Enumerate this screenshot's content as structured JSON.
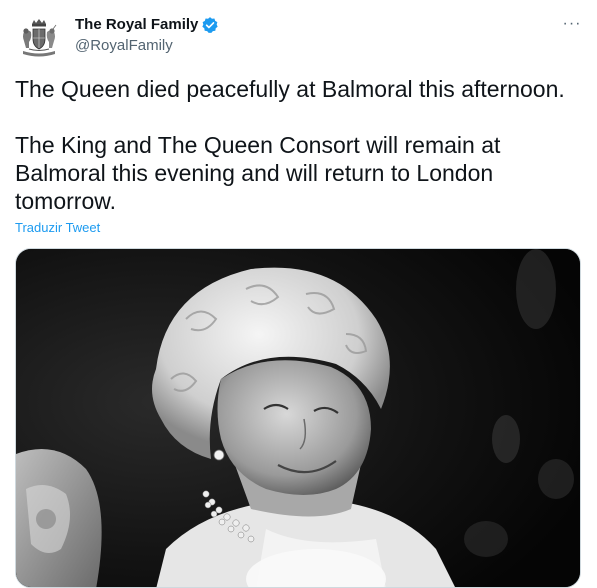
{
  "author": {
    "display_name": "The Royal Family",
    "handle": "@RoyalFamily",
    "verified_icon": "verified-badge-icon",
    "avatar_icon": "royal-coat-of-arms-icon"
  },
  "tweet": {
    "text": "The Queen died peacefully at Balmoral this afternoon.\n\nThe King and The Queen Consort will remain at Balmoral this evening and will return to London tomorrow.",
    "translate_label": "Traduzir Tweet"
  },
  "more_button": {
    "label": "···"
  },
  "media": {
    "description_icon": "portrait-photo"
  },
  "colors": {
    "link": "#1d9bf0",
    "verified": "#1d9bf0",
    "secondary_text": "#536471",
    "primary_text": "#0f1419"
  }
}
